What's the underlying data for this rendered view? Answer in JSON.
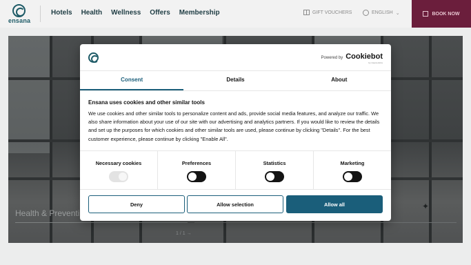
{
  "brand": {
    "name": "ensana"
  },
  "nav": {
    "items": [
      "Hotels",
      "Health",
      "Wellness",
      "Offers",
      "Membership"
    ]
  },
  "header": {
    "gift_vouchers": "GIFT VOUCHERS",
    "language": "ENGLISH",
    "book_now": "BOOK NOW"
  },
  "hero": {
    "title": "Health & Preventi",
    "pager": "1 / 1 →"
  },
  "consent": {
    "powered_by": "Powered by",
    "cookiebot": "Cookiebot",
    "cookiebot_sub": "by Usercentrics",
    "tabs": [
      "Consent",
      "Details",
      "About"
    ],
    "active_tab": "Consent",
    "heading": "Ensana uses cookies and other similar tools",
    "body": "We use cookies and other similar tools to personalize content and ads, provide social media features, and analyze our traffic. We also share information about your use of our site with our advertising and analytics partners. If you would like to review the details and set up the purposes for which cookies and other similar tools are used, please continue by clicking \"Details\". For the best customer experience, please continue by clicking \"Enable All\".",
    "options": [
      {
        "label": "Necessary cookies",
        "state": "disabled-on"
      },
      {
        "label": "Preferences",
        "state": "off"
      },
      {
        "label": "Statistics",
        "state": "off"
      },
      {
        "label": "Marketing",
        "state": "off"
      }
    ],
    "buttons": {
      "deny": "Deny",
      "allow_selection": "Allow selection",
      "allow_all": "Allow all"
    }
  },
  "colors": {
    "accent": "#1a5e7a",
    "brand": "#1d5a66",
    "book_bg": "#6b1e3c"
  }
}
